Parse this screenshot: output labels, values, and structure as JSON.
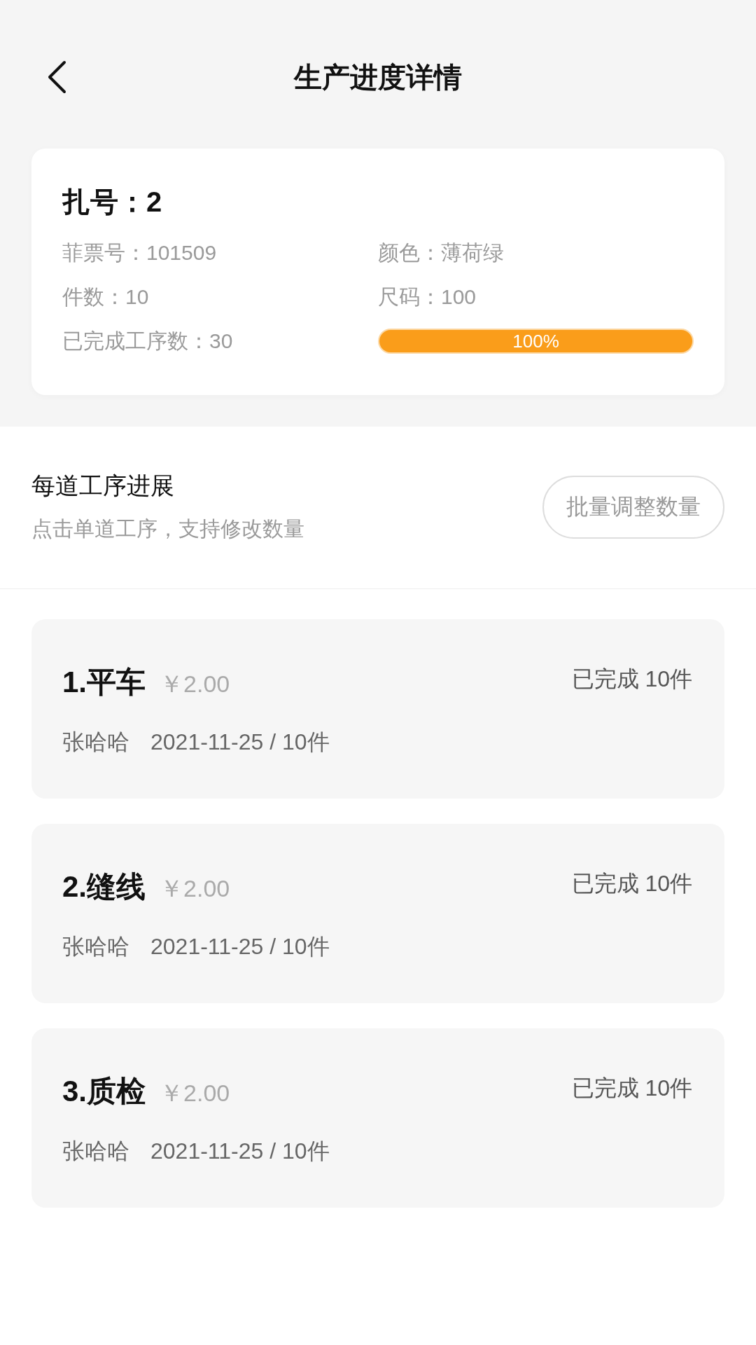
{
  "header": {
    "title": "生产进度详情"
  },
  "bundle": {
    "title": "扎号：2",
    "fields": [
      "菲票号：101509",
      "颜色：薄荷绿",
      "件数：10",
      "尺码：100",
      "已完成工序数：30"
    ],
    "progress": {
      "level": 1,
      "reading": "100%"
    }
  },
  "section": {
    "title": "每道工序进展",
    "subtitle": "点击单道工序，支持修改数量",
    "button": "批量调整数量"
  },
  "processes": [
    {
      "name": "1.平车",
      "price": "￥2.00",
      "status": "已完成 10件",
      "worker": "张哈哈",
      "record": "2021-11-25 / 10件"
    },
    {
      "name": "2.缝线",
      "price": "￥2.00",
      "status": "已完成 10件",
      "worker": "张哈哈",
      "record": "2021-11-25 / 10件"
    },
    {
      "name": "3.质检",
      "price": "￥2.00",
      "status": "已完成 10件",
      "worker": "张哈哈",
      "record": "2021-11-25 / 10件"
    }
  ]
}
